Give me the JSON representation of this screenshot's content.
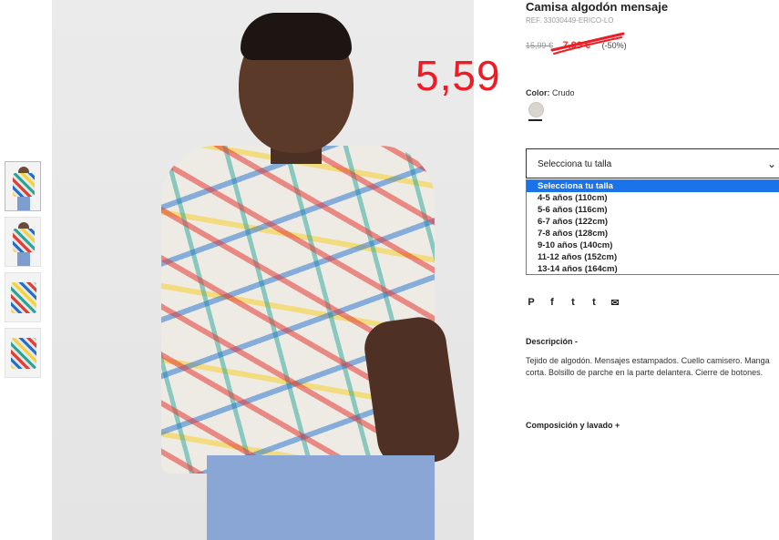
{
  "product": {
    "title": "Camisa algodón mensaje",
    "ref": "REF. 33030449-ERICO-LO",
    "old_price": "15,99 €",
    "new_price": "7,99 €",
    "discount": "(-50%)",
    "color_label": "Color:",
    "color_value": "Crudo"
  },
  "annotation": {
    "text": "5,59",
    "color": "#ee1c24"
  },
  "size_select": {
    "current": "Selecciona tu talla",
    "options": [
      "Selecciona tu talla",
      "4-5 años (110cm)",
      "5-6 años (116cm)",
      "6-7 años (122cm)",
      "7-8 años (128cm)",
      "9-10 años (140cm)",
      "11-12 años (152cm)",
      "13-14 años (164cm)"
    ],
    "highlight_color": "#1a73e8"
  },
  "share": {
    "icons": [
      "pinterest-icon",
      "facebook-icon",
      "twitter-icon",
      "tumblr-icon",
      "email-icon"
    ],
    "glyphs": [
      "P",
      "f",
      "t",
      "t",
      "✉"
    ]
  },
  "description": {
    "heading": "Descripción -",
    "text": "Tejido de algodón. Mensajes estampados. Cuello camisero. Manga corta. Bolsillo de parche en la parte delantera. Cierre de botones."
  },
  "composition": {
    "heading": "Composición y lavado +"
  }
}
